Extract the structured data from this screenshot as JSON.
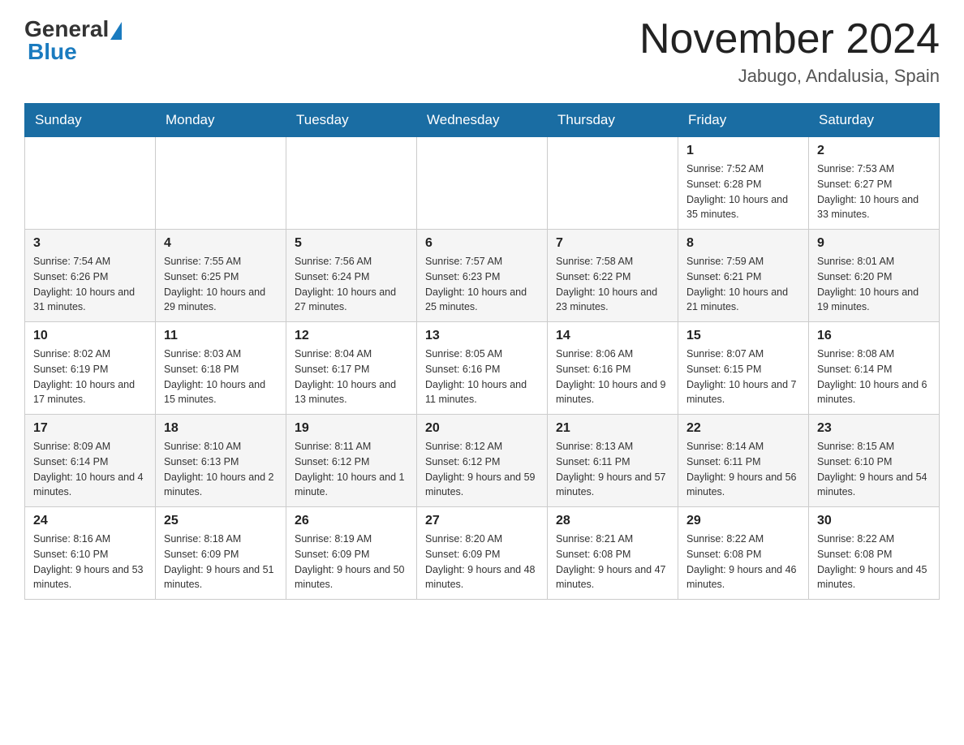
{
  "header": {
    "logo_general": "General",
    "logo_blue": "Blue",
    "month_title": "November 2024",
    "location": "Jabugo, Andalusia, Spain"
  },
  "days_of_week": [
    "Sunday",
    "Monday",
    "Tuesday",
    "Wednesday",
    "Thursday",
    "Friday",
    "Saturday"
  ],
  "weeks": [
    {
      "days": [
        {
          "number": "",
          "info": ""
        },
        {
          "number": "",
          "info": ""
        },
        {
          "number": "",
          "info": ""
        },
        {
          "number": "",
          "info": ""
        },
        {
          "number": "",
          "info": ""
        },
        {
          "number": "1",
          "info": "Sunrise: 7:52 AM\nSunset: 6:28 PM\nDaylight: 10 hours and 35 minutes."
        },
        {
          "number": "2",
          "info": "Sunrise: 7:53 AM\nSunset: 6:27 PM\nDaylight: 10 hours and 33 minutes."
        }
      ]
    },
    {
      "days": [
        {
          "number": "3",
          "info": "Sunrise: 7:54 AM\nSunset: 6:26 PM\nDaylight: 10 hours and 31 minutes."
        },
        {
          "number": "4",
          "info": "Sunrise: 7:55 AM\nSunset: 6:25 PM\nDaylight: 10 hours and 29 minutes."
        },
        {
          "number": "5",
          "info": "Sunrise: 7:56 AM\nSunset: 6:24 PM\nDaylight: 10 hours and 27 minutes."
        },
        {
          "number": "6",
          "info": "Sunrise: 7:57 AM\nSunset: 6:23 PM\nDaylight: 10 hours and 25 minutes."
        },
        {
          "number": "7",
          "info": "Sunrise: 7:58 AM\nSunset: 6:22 PM\nDaylight: 10 hours and 23 minutes."
        },
        {
          "number": "8",
          "info": "Sunrise: 7:59 AM\nSunset: 6:21 PM\nDaylight: 10 hours and 21 minutes."
        },
        {
          "number": "9",
          "info": "Sunrise: 8:01 AM\nSunset: 6:20 PM\nDaylight: 10 hours and 19 minutes."
        }
      ]
    },
    {
      "days": [
        {
          "number": "10",
          "info": "Sunrise: 8:02 AM\nSunset: 6:19 PM\nDaylight: 10 hours and 17 minutes."
        },
        {
          "number": "11",
          "info": "Sunrise: 8:03 AM\nSunset: 6:18 PM\nDaylight: 10 hours and 15 minutes."
        },
        {
          "number": "12",
          "info": "Sunrise: 8:04 AM\nSunset: 6:17 PM\nDaylight: 10 hours and 13 minutes."
        },
        {
          "number": "13",
          "info": "Sunrise: 8:05 AM\nSunset: 6:16 PM\nDaylight: 10 hours and 11 minutes."
        },
        {
          "number": "14",
          "info": "Sunrise: 8:06 AM\nSunset: 6:16 PM\nDaylight: 10 hours and 9 minutes."
        },
        {
          "number": "15",
          "info": "Sunrise: 8:07 AM\nSunset: 6:15 PM\nDaylight: 10 hours and 7 minutes."
        },
        {
          "number": "16",
          "info": "Sunrise: 8:08 AM\nSunset: 6:14 PM\nDaylight: 10 hours and 6 minutes."
        }
      ]
    },
    {
      "days": [
        {
          "number": "17",
          "info": "Sunrise: 8:09 AM\nSunset: 6:14 PM\nDaylight: 10 hours and 4 minutes."
        },
        {
          "number": "18",
          "info": "Sunrise: 8:10 AM\nSunset: 6:13 PM\nDaylight: 10 hours and 2 minutes."
        },
        {
          "number": "19",
          "info": "Sunrise: 8:11 AM\nSunset: 6:12 PM\nDaylight: 10 hours and 1 minute."
        },
        {
          "number": "20",
          "info": "Sunrise: 8:12 AM\nSunset: 6:12 PM\nDaylight: 9 hours and 59 minutes."
        },
        {
          "number": "21",
          "info": "Sunrise: 8:13 AM\nSunset: 6:11 PM\nDaylight: 9 hours and 57 minutes."
        },
        {
          "number": "22",
          "info": "Sunrise: 8:14 AM\nSunset: 6:11 PM\nDaylight: 9 hours and 56 minutes."
        },
        {
          "number": "23",
          "info": "Sunrise: 8:15 AM\nSunset: 6:10 PM\nDaylight: 9 hours and 54 minutes."
        }
      ]
    },
    {
      "days": [
        {
          "number": "24",
          "info": "Sunrise: 8:16 AM\nSunset: 6:10 PM\nDaylight: 9 hours and 53 minutes."
        },
        {
          "number": "25",
          "info": "Sunrise: 8:18 AM\nSunset: 6:09 PM\nDaylight: 9 hours and 51 minutes."
        },
        {
          "number": "26",
          "info": "Sunrise: 8:19 AM\nSunset: 6:09 PM\nDaylight: 9 hours and 50 minutes."
        },
        {
          "number": "27",
          "info": "Sunrise: 8:20 AM\nSunset: 6:09 PM\nDaylight: 9 hours and 48 minutes."
        },
        {
          "number": "28",
          "info": "Sunrise: 8:21 AM\nSunset: 6:08 PM\nDaylight: 9 hours and 47 minutes."
        },
        {
          "number": "29",
          "info": "Sunrise: 8:22 AM\nSunset: 6:08 PM\nDaylight: 9 hours and 46 minutes."
        },
        {
          "number": "30",
          "info": "Sunrise: 8:22 AM\nSunset: 6:08 PM\nDaylight: 9 hours and 45 minutes."
        }
      ]
    }
  ]
}
